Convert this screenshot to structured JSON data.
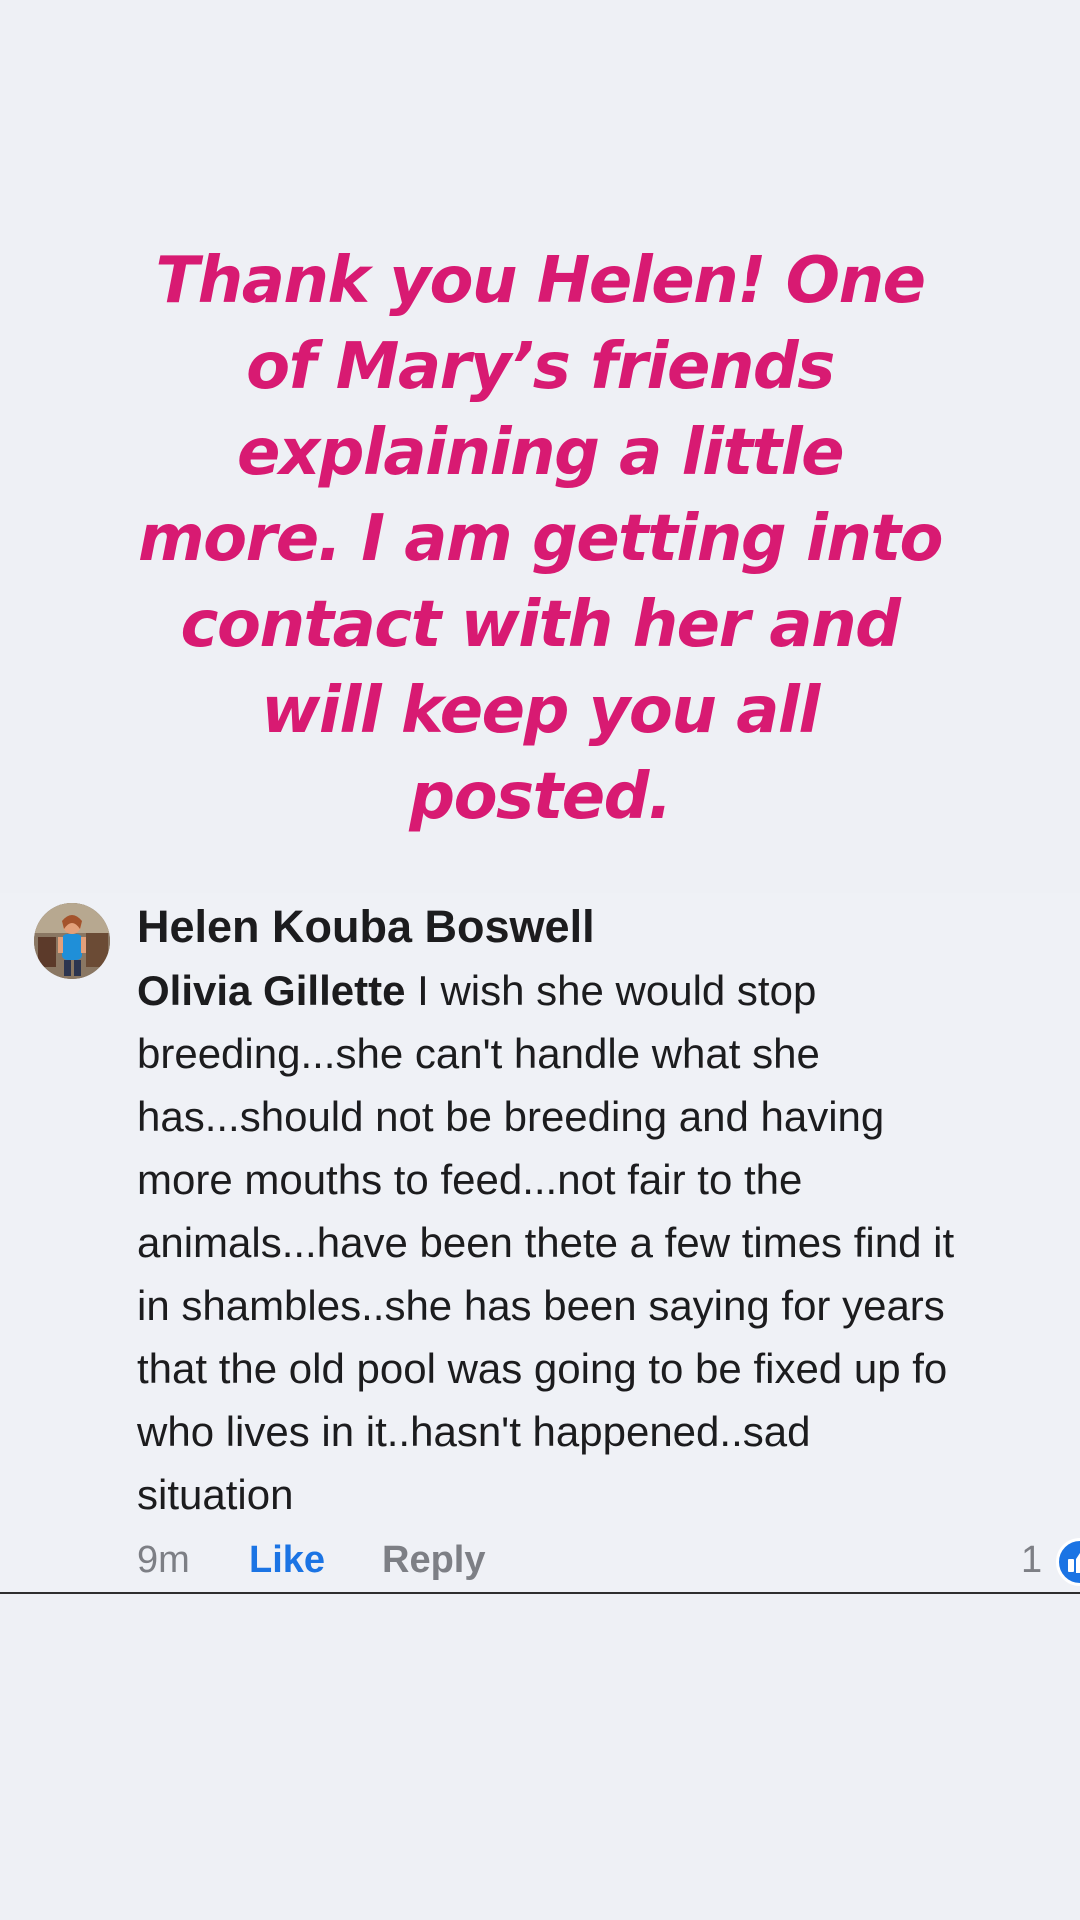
{
  "caption": {
    "lines": [
      "Thank you Helen! One",
      "of Mary’s friends",
      "explaining a little",
      "more. I am getting into",
      "contact with her and",
      "will keep you all",
      "posted."
    ],
    "color": "#d81a72"
  },
  "comment": {
    "author": "Helen Kouba Boswell",
    "mention": "Olivia Gillette",
    "text_lines": [
      " I wish she would stop",
      "breeding...she can't handle what she",
      "has...should not be breeding and having",
      "more mouths to feed...not fair to the",
      "animals...have been thete a few times find it",
      "in shambles..she has been saying for years",
      "that the old pool was going to be fixed up fo",
      "who lives in it..hasn't happened..sad",
      "situation"
    ],
    "time": "9m",
    "like_label": "Like",
    "reply_label": "Reply",
    "reaction_count": "1",
    "reaction_icon": "like-reaction-icon",
    "like_color": "#1b74e4"
  }
}
